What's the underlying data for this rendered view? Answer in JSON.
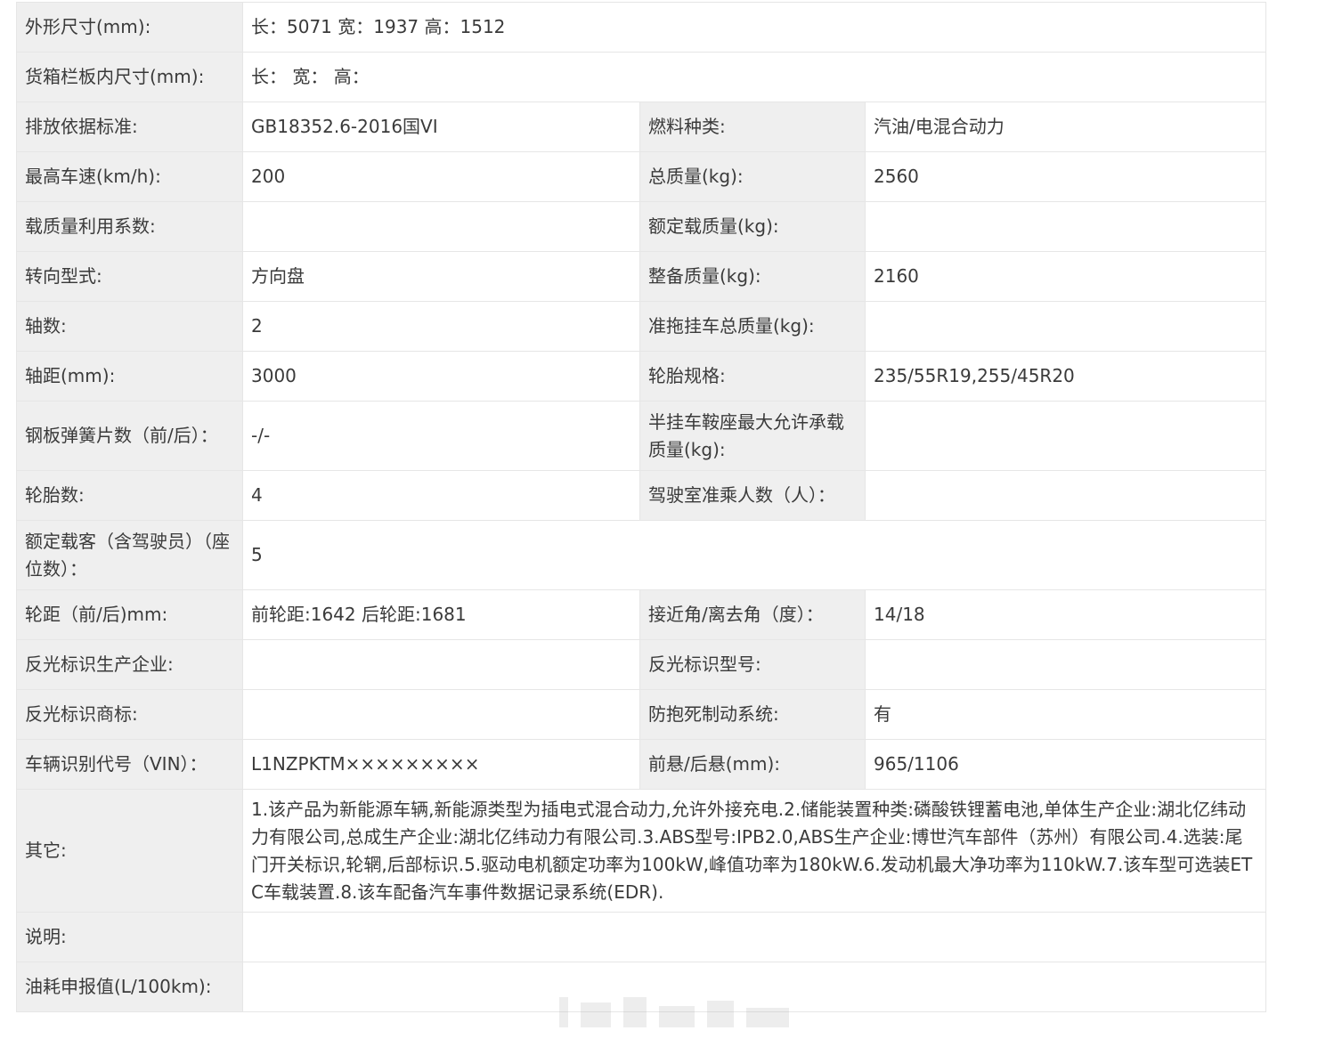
{
  "rows": [
    {
      "type": "full",
      "label": "外形尺寸(mm):",
      "value": "长：5071 宽：1937 高：1512"
    },
    {
      "type": "full",
      "label": "货箱栏板内尺寸(mm):",
      "value": "长： 宽： 高："
    },
    {
      "type": "pair",
      "label1": "排放依据标准:",
      "value1": "GB18352.6-2016国VI",
      "label2": "燃料种类:",
      "value2": "汽油/电混合动力"
    },
    {
      "type": "pair",
      "label1": "最高车速(km/h):",
      "value1": "200",
      "label2": "总质量(kg):",
      "value2": "2560"
    },
    {
      "type": "pair",
      "label1": "载质量利用系数:",
      "value1": "",
      "label2": "额定载质量(kg):",
      "value2": ""
    },
    {
      "type": "pair",
      "label1": "转向型式:",
      "value1": "方向盘",
      "label2": "整备质量(kg):",
      "value2": "2160"
    },
    {
      "type": "pair",
      "label1": "轴数:",
      "value1": "2",
      "label2": "准拖挂车总质量(kg):",
      "value2": ""
    },
    {
      "type": "pair",
      "label1": "轴距(mm):",
      "value1": "3000",
      "label2": "轮胎规格:",
      "value2": "235/55R19,255/45R20"
    },
    {
      "type": "pair",
      "label1": "钢板弹簧片数（前/后）：",
      "value1": "-/-",
      "label2": "半挂车鞍座最大允许承载质量(kg):",
      "value2": ""
    },
    {
      "type": "pair",
      "label1": "轮胎数:",
      "value1": "4",
      "label2": "驾驶室准乘人数（人）：",
      "value2": ""
    },
    {
      "type": "full",
      "label": "额定载客（含驾驶员）（座位数）：",
      "value": "5"
    },
    {
      "type": "pair",
      "label1": "轮距（前/后)mm:",
      "value1": "前轮距:1642 后轮距:1681",
      "label2": "接近角/离去角（度）：",
      "value2": "14/18"
    },
    {
      "type": "pair",
      "label1": "反光标识生产企业:",
      "value1": "",
      "label2": "反光标识型号:",
      "value2": ""
    },
    {
      "type": "pair",
      "label1": "反光标识商标:",
      "value1": "",
      "label2": "防抱死制动系统:",
      "value2": "有"
    },
    {
      "type": "pair",
      "label1": "车辆识别代号（VIN）：",
      "value1": "L1NZPKTM×××××××××",
      "label2": "前悬/后悬(mm):",
      "value2": "965/1106"
    },
    {
      "type": "full",
      "label": "其它:",
      "value": "1.该产品为新能源车辆,新能源类型为插电式混合动力,允许外接充电.2.储能装置种类:磷酸铁锂蓄电池,单体生产企业:湖北亿纬动力有限公司,总成生产企业:湖北亿纬动力有限公司.3.ABS型号:IPB2.0,ABS生产企业:博世汽车部件（苏州）有限公司.4.选装:尾门开关标识,轮辋,后部标识.5.驱动电机额定功率为100kW,峰值功率为180kW.6.发动机最大净功率为110kW.7.该车型可选装ETC车载装置.8.该车配备汽车事件数据记录系统(EDR)."
    },
    {
      "type": "full",
      "label": "说明:",
      "value": ""
    },
    {
      "type": "full",
      "label": "油耗申报值(L/100km):",
      "value": ""
    }
  ]
}
